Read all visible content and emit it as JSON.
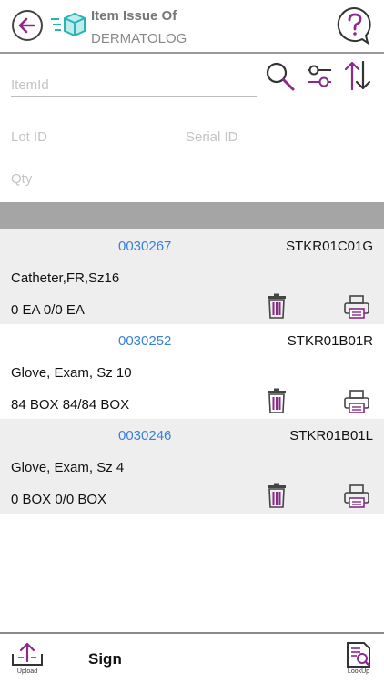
{
  "header": {
    "title": "Item Issue Of",
    "subtitle": "DERMATOLOG"
  },
  "form": {
    "item_id_placeholder": "ItemId",
    "lot_id_placeholder": "Lot ID",
    "serial_id_placeholder": "Serial ID",
    "qty_placeholder": "Qty"
  },
  "items": [
    {
      "id": "0030267",
      "location": "STKR01C01G",
      "description": "Catheter,FR,Sz16",
      "qty": "0 EA  0/0 EA"
    },
    {
      "id": "0030252",
      "location": "STKR01B01R",
      "description": "Glove, Exam, Sz 10",
      "qty": "84 BOX  84/84 BOX"
    },
    {
      "id": "0030246",
      "location": "STKR01B01L",
      "description": "Glove, Exam, Sz 4",
      "qty": "0 BOX  0/0 BOX"
    }
  ],
  "footer": {
    "upload_label": "Upload",
    "sign_label": "Sign",
    "lookup_label": "LookUp"
  },
  "colors": {
    "accent_purple": "#8b2a8b",
    "link_blue": "#3a82d6",
    "teal": "#29b3b3"
  }
}
